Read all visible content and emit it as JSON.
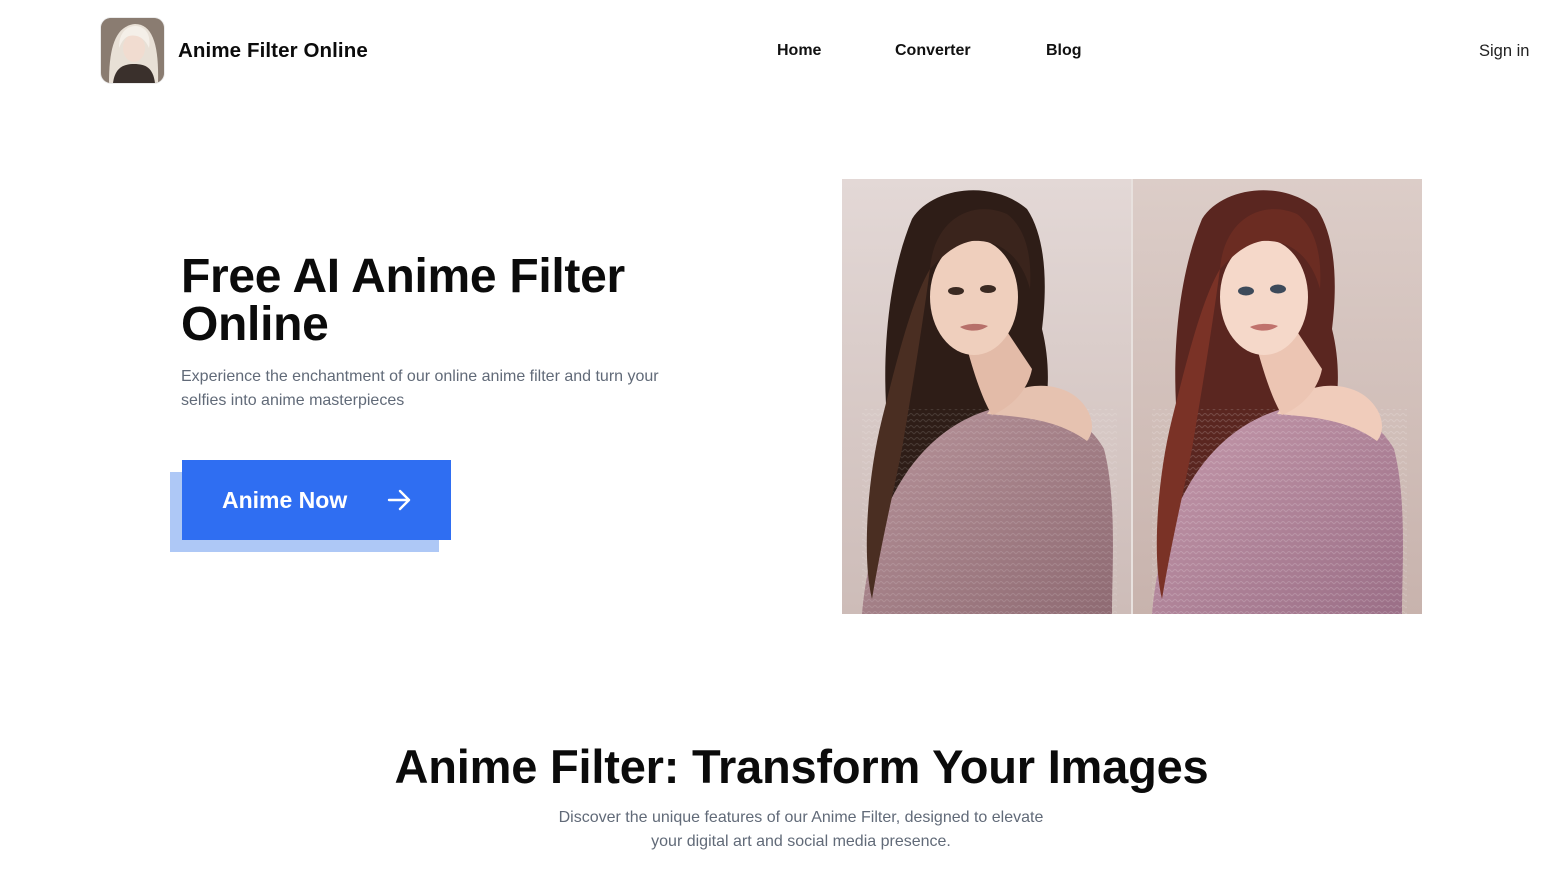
{
  "header": {
    "brand": "Anime Filter Online",
    "logo_icon": "avatar-portrait-icon",
    "nav": [
      {
        "label": "Home"
      },
      {
        "label": "Converter"
      },
      {
        "label": "Blog"
      }
    ],
    "sign_in": "Sign in"
  },
  "hero": {
    "title": "Free AI Anime Filter Online",
    "subtitle": "Experience the enchantment of our online anime filter and turn your selfies into anime masterpieces",
    "cta_label": "Anime Now",
    "cta_icon": "arrow-right-icon",
    "comparison_image": {
      "left": "original-photo",
      "right": "anime-filtered-photo"
    }
  },
  "features": {
    "title": "Anime Filter: Transform Your Images",
    "subtitle": "Discover the unique features of our Anime Filter, designed to elevate your digital art and social media presence."
  },
  "colors": {
    "accent": "#2f6ef2",
    "accent_shadow": "#aec8f6",
    "muted_text": "#616a78",
    "heading_text": "#0b0b0b"
  }
}
